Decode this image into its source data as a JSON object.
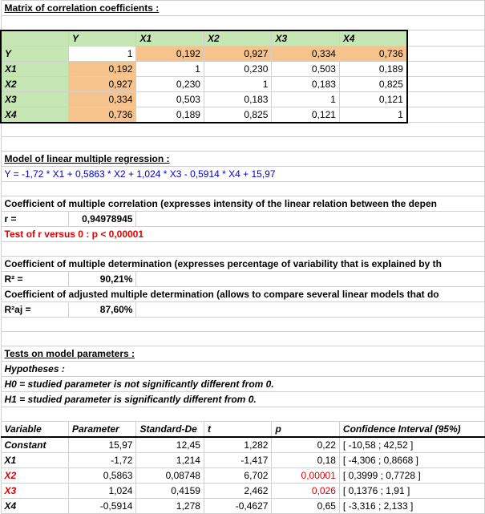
{
  "titles": {
    "matrix": "Matrix of correlation coefficients :",
    "model": "Model of linear multiple regression :",
    "coeffMult": "Coefficient of multiple correlation (expresses intensity of the linear relation between the depen",
    "coeffDet": "Coefficient of multiple determination (expresses percentage of variability that is explained by th",
    "coeffAdj": "Coefficient of adjusted multiple determination (allows to compare several linear models that do",
    "tests": "Tests on model parameters :",
    "hyp": "Hypotheses :",
    "h0": "H0 = studied parameter is not significantly different from 0.",
    "h1": "H1 = studied parameter is significantly different from 0."
  },
  "corr": {
    "headers": [
      "Y",
      "X1",
      "X2",
      "X3",
      "X4"
    ],
    "rows": [
      {
        "label": "Y",
        "vals": [
          "1",
          "0,192",
          "0,927",
          "0,334",
          "0,736"
        ]
      },
      {
        "label": "X1",
        "vals": [
          "0,192",
          "1",
          "0,230",
          "0,503",
          "0,189"
        ]
      },
      {
        "label": "X2",
        "vals": [
          "0,927",
          "0,230",
          "1",
          "0,183",
          "0,825"
        ]
      },
      {
        "label": "X3",
        "vals": [
          "0,334",
          "0,503",
          "0,183",
          "1",
          "0,121"
        ]
      },
      {
        "label": "X4",
        "vals": [
          "0,736",
          "0,189",
          "0,825",
          "0,121",
          "1"
        ]
      }
    ]
  },
  "equation": "Y = -1,72 * X1 + 0,5863 * X2 + 1,024 * X3 - 0,5914 * X4 + 15,97",
  "r_label": "r =",
  "r_val": "0,94978945",
  "r_test": "Test of r versus 0 : p < 0,00001",
  "r2_label": "R² =",
  "r2_val": "90,21%",
  "r2aj_label": "R²aj =",
  "r2aj_val": "87,60%",
  "param_headers": {
    "var": "Variable",
    "param": "Parameter",
    "sd": "Standard-De",
    "t": "t",
    "p": "p",
    "ci": "Confidence Interval (95%)"
  },
  "params": [
    {
      "v": "Constant",
      "p": "15,97",
      "sd": "12,45",
      "t": "1,282",
      "pv": "0,22",
      "ci": "[ -10,58 ; 42,52 ]",
      "red": false
    },
    {
      "v": "X1",
      "p": "-1,72",
      "sd": "1,214",
      "t": "-1,417",
      "pv": "0,18",
      "ci": "[ -4,306 ; 0,8668 ]",
      "red": false
    },
    {
      "v": "X2",
      "p": "0,5863",
      "sd": "0,08748",
      "t": "6,702",
      "pv": "0,00001",
      "ci": "[ 0,3999 ; 0,7728 ]",
      "red": true
    },
    {
      "v": "X3",
      "p": "1,024",
      "sd": "0,4159",
      "t": "2,462",
      "pv": "0,026",
      "ci": "[ 0,1376 ; 1,91 ]",
      "red": true
    },
    {
      "v": "X4",
      "p": "-0,5914",
      "sd": "1,278",
      "t": "-0,4627",
      "pv": "0,65",
      "ci": "[ -3,316 ; 2,133 ]",
      "red": false
    }
  ],
  "chart_data": {
    "type": "table",
    "title": "Matrix of correlation coefficients",
    "categories": [
      "Y",
      "X1",
      "X2",
      "X3",
      "X4"
    ],
    "series": [
      {
        "name": "Y",
        "values": [
          1,
          0.192,
          0.927,
          0.334,
          0.736
        ]
      },
      {
        "name": "X1",
        "values": [
          0.192,
          1,
          0.23,
          0.503,
          0.189
        ]
      },
      {
        "name": "X2",
        "values": [
          0.927,
          0.23,
          1,
          0.183,
          0.825
        ]
      },
      {
        "name": "X3",
        "values": [
          0.334,
          0.503,
          0.183,
          1,
          0.121
        ]
      },
      {
        "name": "X4",
        "values": [
          0.736,
          0.189,
          0.825,
          0.121,
          1
        ]
      }
    ]
  }
}
